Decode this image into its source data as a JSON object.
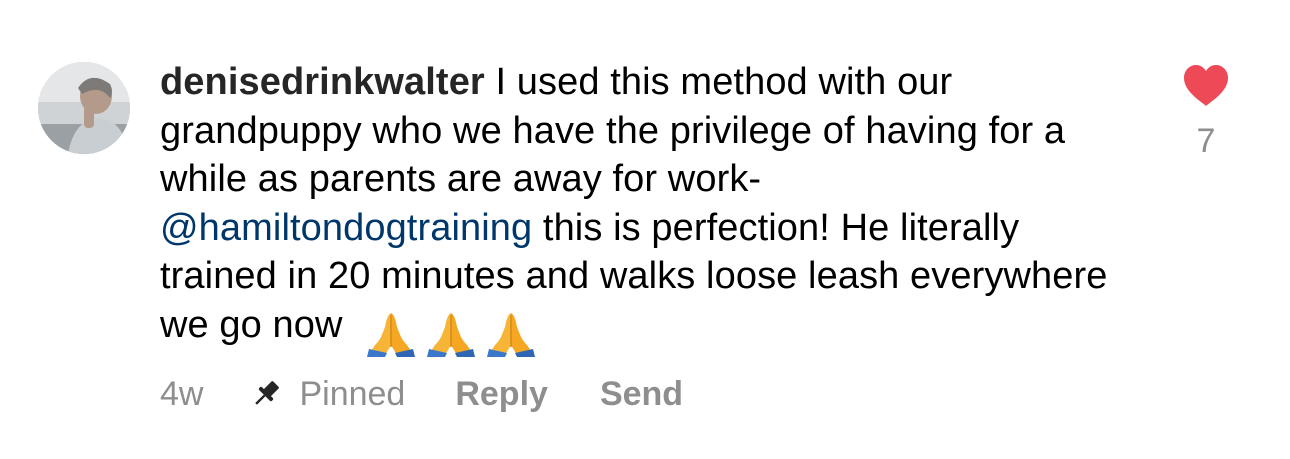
{
  "comment": {
    "avatar_icon": "profile-photo",
    "username": "denisedrinkwalter",
    "text_part1": " I used this method with our grandpuppy who we have the privilege of having for a while as parents are away for work- ",
    "mention": "@hamiltondogtraining",
    "text_part2": " this is perfection!  He literally trained in 20 minutes and walks loose leash everywhere we go now ",
    "emojis": [
      "folded-hands-emoji",
      "folded-hands-emoji",
      "folded-hands-emoji"
    ],
    "time": "4w",
    "pinned_label": "Pinned",
    "pin_icon": "pin-icon",
    "reply_label": "Reply",
    "send_label": "Send",
    "like_icon": "heart-icon",
    "like_count": "7",
    "colors": {
      "username": "#262626",
      "mention": "#00376b",
      "muted": "#8e8e8e",
      "heart": "#ed4956"
    }
  }
}
